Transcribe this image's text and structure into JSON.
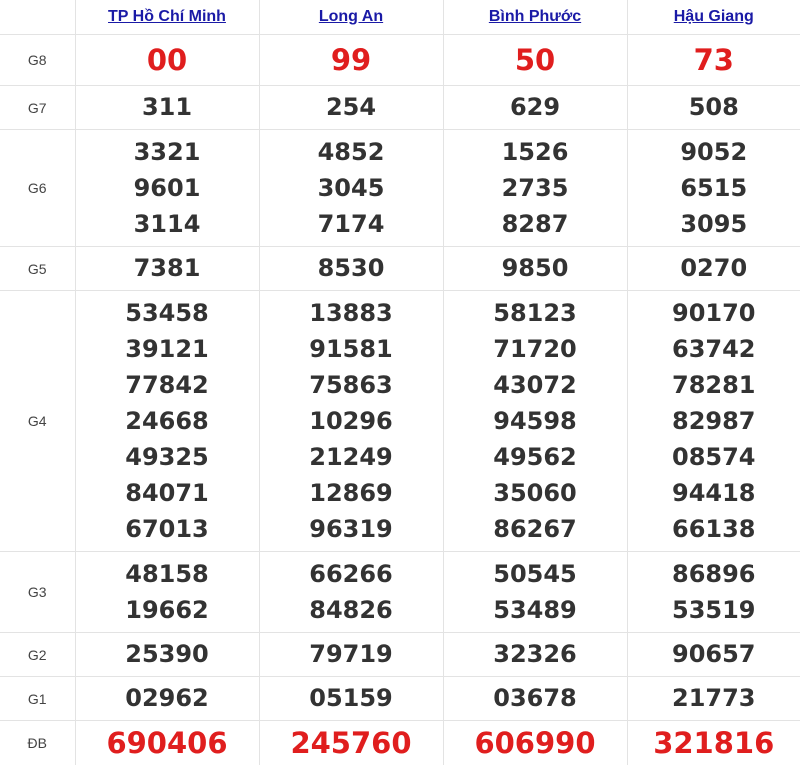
{
  "provinces": [
    "TP Hồ Chí Minh",
    "Long An",
    "Bình Phước",
    "Hậu Giang"
  ],
  "prizes": [
    {
      "label": "G8",
      "values": [
        [
          "00"
        ],
        [
          "99"
        ],
        [
          "50"
        ],
        [
          "73"
        ]
      ]
    },
    {
      "label": "G7",
      "values": [
        [
          "311"
        ],
        [
          "254"
        ],
        [
          "629"
        ],
        [
          "508"
        ]
      ]
    },
    {
      "label": "G6",
      "values": [
        [
          "3321",
          "9601",
          "3114"
        ],
        [
          "4852",
          "3045",
          "7174"
        ],
        [
          "1526",
          "2735",
          "8287"
        ],
        [
          "9052",
          "6515",
          "3095"
        ]
      ]
    },
    {
      "label": "G5",
      "values": [
        [
          "7381"
        ],
        [
          "8530"
        ],
        [
          "9850"
        ],
        [
          "0270"
        ]
      ]
    },
    {
      "label": "G4",
      "values": [
        [
          "53458",
          "39121",
          "77842",
          "24668",
          "49325",
          "84071",
          "67013"
        ],
        [
          "13883",
          "91581",
          "75863",
          "10296",
          "21249",
          "12869",
          "96319"
        ],
        [
          "58123",
          "71720",
          "43072",
          "94598",
          "49562",
          "35060",
          "86267"
        ],
        [
          "90170",
          "63742",
          "78281",
          "82987",
          "08574",
          "94418",
          "66138"
        ]
      ]
    },
    {
      "label": "G3",
      "values": [
        [
          "48158",
          "19662"
        ],
        [
          "66266",
          "84826"
        ],
        [
          "50545",
          "53489"
        ],
        [
          "86896",
          "53519"
        ]
      ]
    },
    {
      "label": "G2",
      "values": [
        [
          "25390"
        ],
        [
          "79719"
        ],
        [
          "32326"
        ],
        [
          "90657"
        ]
      ]
    },
    {
      "label": "G1",
      "values": [
        [
          "02962"
        ],
        [
          "05159"
        ],
        [
          "03678"
        ],
        [
          "21773"
        ]
      ]
    },
    {
      "label": "ĐB",
      "values": [
        [
          "690406"
        ],
        [
          "245760"
        ],
        [
          "606990"
        ],
        [
          "321816"
        ]
      ]
    }
  ],
  "colors": {
    "special": "#e01e1e",
    "number": "#333333",
    "link": "#1a1aa6",
    "border": "#e3e3e3"
  }
}
